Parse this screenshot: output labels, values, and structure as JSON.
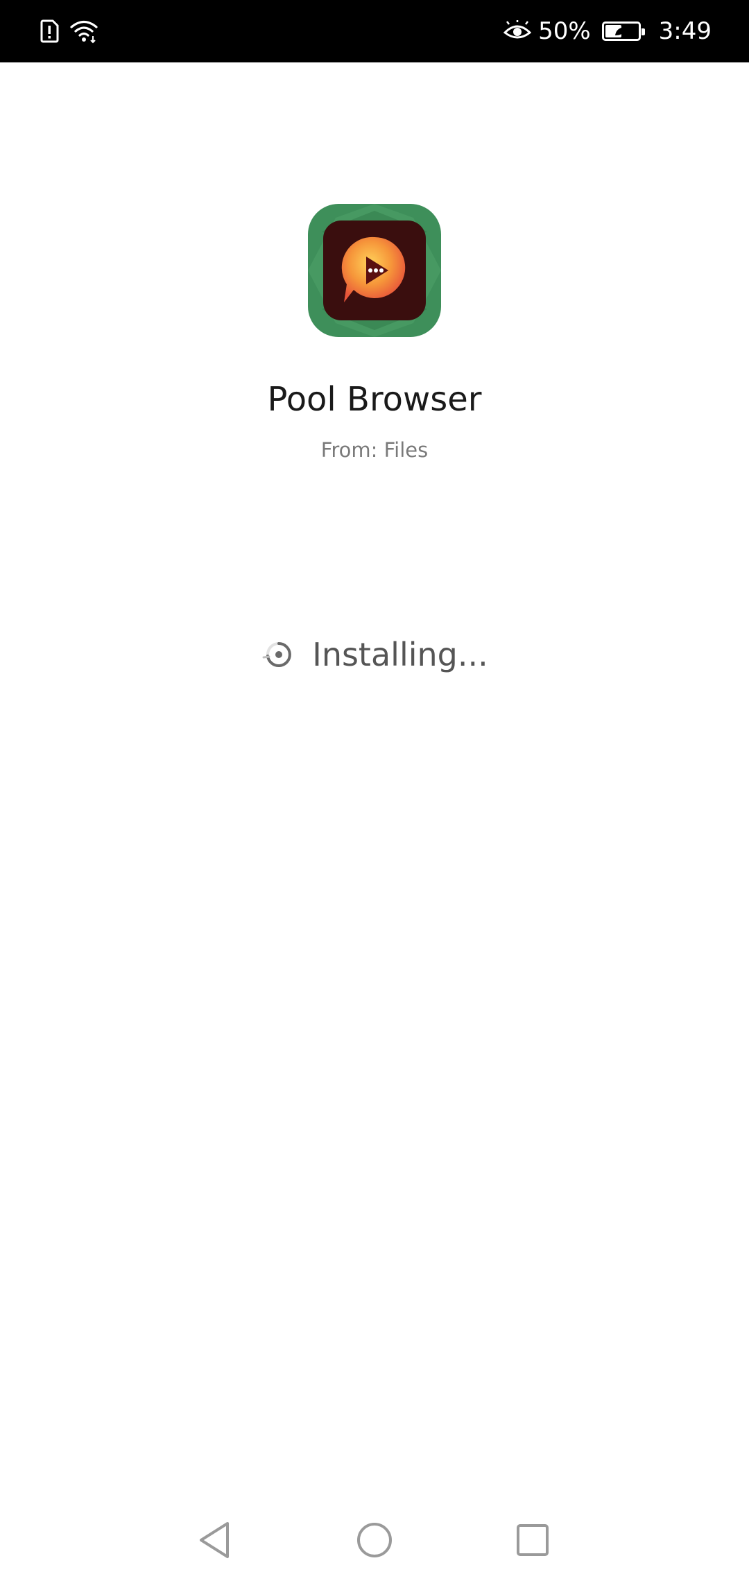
{
  "status_bar": {
    "icons": [
      "sim-alert-icon",
      "wifi-icon",
      "eye-comfort-icon",
      "battery-icon"
    ],
    "battery_percent": "50%",
    "battery_level": 0.5,
    "time": "3:49"
  },
  "app": {
    "name": "Pool Browser",
    "source": "From: Files",
    "icon": "pool-browser-app-icon"
  },
  "install": {
    "status_text": "Installing...",
    "icon": "loading-spinner-icon"
  },
  "nav_bar": {
    "icons": [
      "back-icon",
      "home-icon",
      "recent-apps-icon"
    ]
  },
  "colors": {
    "status_bar_bg": "#000000",
    "background": "#ffffff",
    "icon_green": "#3e8f5a",
    "icon_dark": "#3a0e0e",
    "icon_orange": "#f5a23a",
    "text_primary": "#1a1a1a",
    "text_secondary": "#7a7a7a"
  }
}
